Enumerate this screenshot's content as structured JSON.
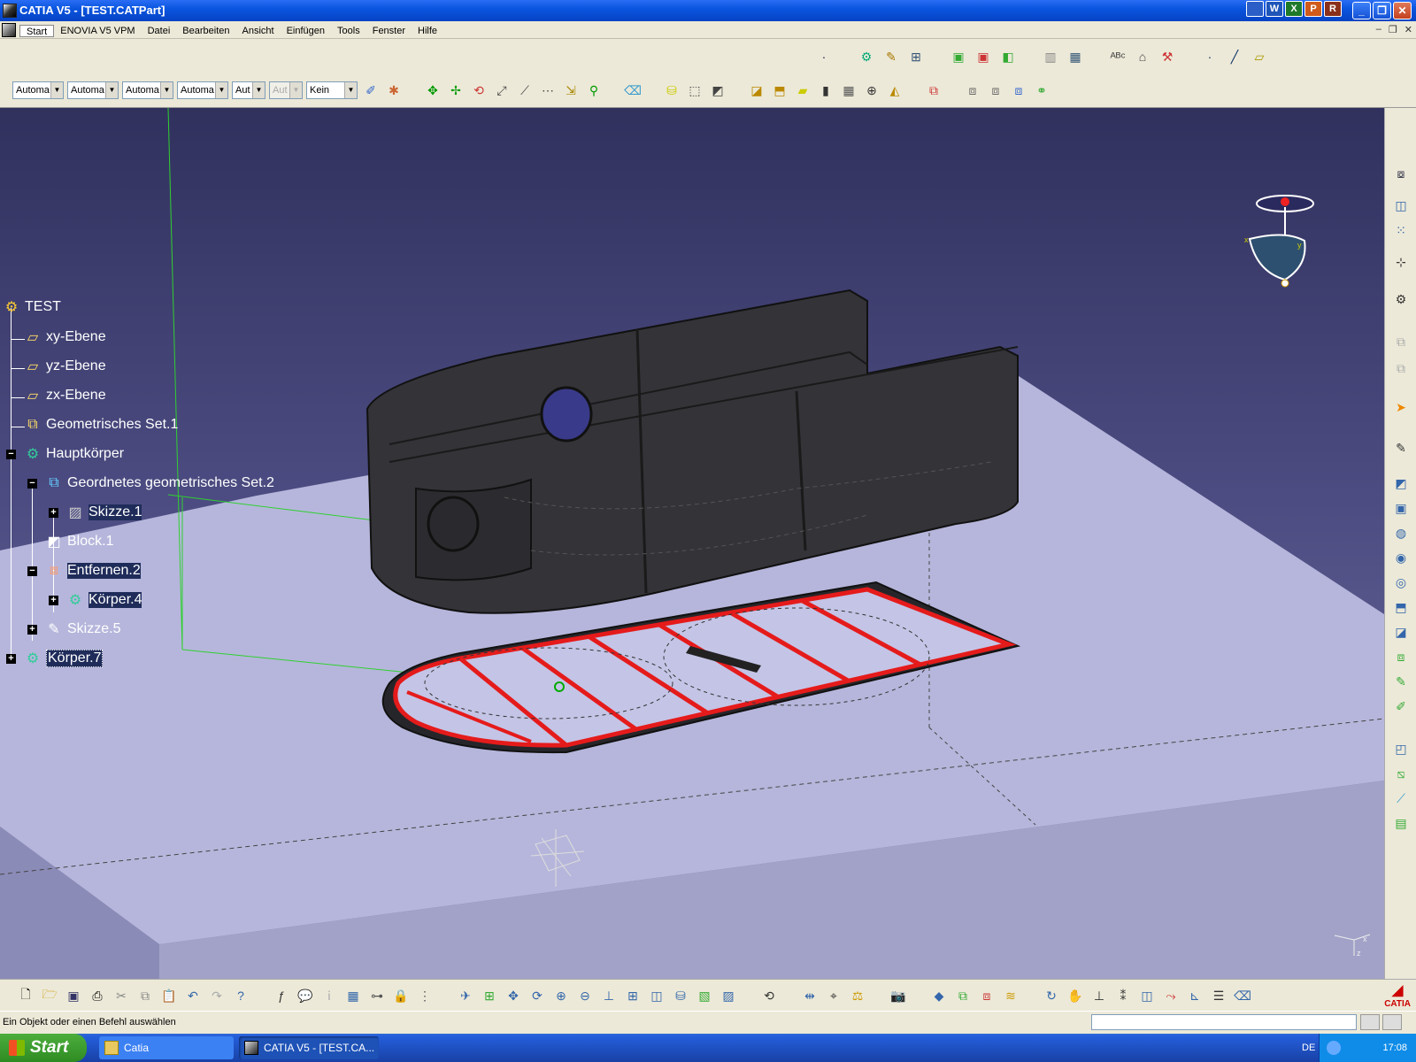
{
  "window": {
    "title": "CATIA V5 - [TEST.CATPart]",
    "tray_buttons": [
      "W",
      "X",
      "P",
      "R"
    ],
    "buttons": {
      "minimize": "_",
      "maximize": "❐",
      "close": "✕"
    }
  },
  "menu": {
    "items": [
      "Start",
      "ENOVIA V5 VPM",
      "Datei",
      "Bearbeiten",
      "Ansicht",
      "Einfügen",
      "Tools",
      "Fenster",
      "Hilfe"
    ],
    "mdi": [
      "–",
      "❐",
      "✕"
    ]
  },
  "toolbar": {
    "combos": [
      "Automa",
      "Automa",
      "Automa",
      "Automa",
      "Aut",
      "Aut",
      "Kein"
    ],
    "combo_disabled_index": 5
  },
  "tree": {
    "root": "TEST",
    "items": [
      {
        "label": "xy-Ebene"
      },
      {
        "label": "yz-Ebene"
      },
      {
        "label": "zx-Ebene"
      },
      {
        "label": "Geometrisches Set.1"
      },
      {
        "label": "Hauptkörper"
      },
      {
        "label": "Geordnetes geometrisches Set.2"
      },
      {
        "label": "Skizze.1"
      },
      {
        "label": "Block.1"
      },
      {
        "label": "Entfernen.2"
      },
      {
        "label": "Körper.4"
      },
      {
        "label": "Skizze.5"
      },
      {
        "label": "Körper.7"
      }
    ]
  },
  "compass": {
    "x": "x",
    "y": "y",
    "z": "z"
  },
  "status": {
    "message": "Ein Objekt oder einen Befehl auswählen"
  },
  "taskbar": {
    "start": "Start",
    "tasks": [
      "Catia",
      "CATIA V5 - [TEST.CA..."
    ],
    "language": "DE",
    "time": "17:08"
  },
  "logo": {
    "text": "CATIA"
  },
  "colors": {
    "titlebar": "#0a55e0",
    "viewport_top": "#31315e",
    "viewport_bottom": "#7373a3",
    "selection_red": "#e51b1b",
    "grid_floor": "#b8b8e0"
  }
}
